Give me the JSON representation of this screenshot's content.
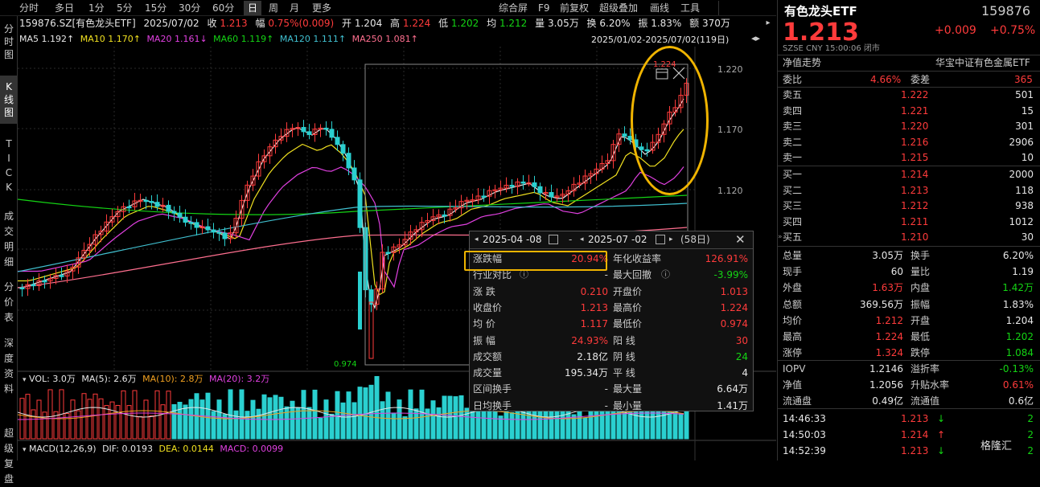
{
  "toolbar": {
    "items": [
      "分时",
      "多日",
      "1分",
      "5分",
      "15分",
      "30分",
      "60分",
      "日",
      "周",
      "月",
      "更多"
    ],
    "right": [
      "综合屏",
      "F9",
      "前复权",
      "超级叠加",
      "画线",
      "工具"
    ]
  },
  "lefttabs": [
    "分时图",
    "K线图",
    "TICK",
    "成交明细",
    "分价表",
    "深度资料",
    "超级复盘"
  ],
  "info": {
    "code": "159876.SZ[有色龙头ETF]",
    "date": "2025/07/02",
    "close_label": "收",
    "close": "1.213",
    "chg_label": "幅",
    "chg": "0.75%(0.009)",
    "open_label": "开",
    "open": "1.204",
    "high_label": "高",
    "high": "1.224",
    "low_label": "低",
    "low": "1.202",
    "avg_label": "均",
    "avg": "1.212",
    "vol_label": "量",
    "vol": "3.05万",
    "turn_label": "换",
    "turn": "6.20%",
    "amp_label": "振",
    "amp": "1.83%",
    "amt_label": "额",
    "amt": "370万"
  },
  "ma": {
    "ma5": "MA5  1.192↑",
    "ma10": "MA10  1.170↑",
    "ma20": "MA20  1.161↓",
    "ma60": "MA60  1.119↑",
    "ma120": "MA120  1.111↑",
    "ma250": "MA250  1.081↑"
  },
  "range_label": "2025/01/02-2025/07/02(119日)",
  "price_axis": [
    "1.220",
    "1.170",
    "1.120"
  ],
  "sel_box": {
    "high": "1.224",
    "low": "0.974"
  },
  "vol_line": {
    "vol": "VOL: 3.0万",
    "ma5": "MA(5): 2.6万",
    "ma10": "MA(10): 2.8万",
    "ma20": "MA(20): 3.2万"
  },
  "macd_line": {
    "macd_label": "MACD(12,26,9)",
    "dif": "DIF: 0.0193",
    "dea": "DEA: 0.0144",
    "macd": "MACD: 0.0099"
  },
  "popup": {
    "from": "2025-04 -08",
    "to": "2025-07 -02",
    "days": "(58日)",
    "rows": [
      {
        "l": "涨跌幅",
        "lv": "20.94%",
        "r": "年化收益率",
        "rv": "126.91%"
      },
      {
        "l": "行业对比",
        "lv": "-",
        "r": "最大回撤",
        "rv": "-3.99%"
      },
      {
        "l": "涨  跌",
        "lv": "0.210",
        "r": "开盘价",
        "rv": "1.013"
      },
      {
        "l": "收盘价",
        "lv": "1.213",
        "r": "最高价",
        "rv": "1.224"
      },
      {
        "l": "均  价",
        "lv": "1.117",
        "r": "最低价",
        "rv": "0.974"
      },
      {
        "l": "振  幅",
        "lv": "24.93%",
        "r": "阳  线",
        "rv": "30"
      },
      {
        "l": "成交额",
        "lv": "2.18亿",
        "r": "阴  线",
        "rv": "24"
      },
      {
        "l": "成交量",
        "lv": "195.34万",
        "r": "平  线",
        "rv": "4"
      },
      {
        "l": "区间换手",
        "lv": "-",
        "r": "最大量",
        "rv": "6.64万"
      },
      {
        "l": "日均换手",
        "lv": "-",
        "r": "最小量",
        "rv": "1.41万"
      }
    ]
  },
  "right": {
    "name": "有色龙头ETF",
    "code": "159876",
    "price": "1.213",
    "chg": "+0.009",
    "pct": "+0.75%",
    "market": "SZSE  CNY  15:00:06  闭市",
    "nav_trend": "净值走势",
    "index": "华宝中证有色金属ETF",
    "webi_label": "委比",
    "webi": "4.66%",
    "weicha_label": "委差",
    "weicha": "365",
    "asks": [
      [
        "卖五",
        "1.222",
        "501"
      ],
      [
        "卖四",
        "1.221",
        "15"
      ],
      [
        "卖三",
        "1.220",
        "301"
      ],
      [
        "卖二",
        "1.216",
        "2906"
      ],
      [
        "卖一",
        "1.215",
        "10"
      ]
    ],
    "bids": [
      [
        "买一",
        "1.214",
        "2000"
      ],
      [
        "买二",
        "1.213",
        "118"
      ],
      [
        "买三",
        "1.212",
        "938"
      ],
      [
        "买四",
        "1.211",
        "1012"
      ],
      [
        "买五",
        "1.210",
        "30"
      ]
    ],
    "stats": [
      [
        "总量",
        "3.05万",
        "换手",
        "6.20%"
      ],
      [
        "现手",
        "60",
        "量比",
        "1.19"
      ],
      [
        "外盘",
        "1.63万",
        "内盘",
        "1.42万"
      ],
      [
        "总额",
        "369.56万",
        "振幅",
        "1.83%"
      ],
      [
        "均价",
        "1.212",
        "开盘",
        "1.204"
      ],
      [
        "最高",
        "1.224",
        "最低",
        "1.202"
      ],
      [
        "涨停",
        "1.324",
        "跌停",
        "1.084"
      ]
    ],
    "stats2": [
      [
        "IOPV",
        "1.2146",
        "溢折率",
        "-0.13%"
      ],
      [
        "净值",
        "1.2056",
        "升贴水率",
        "0.61%"
      ],
      [
        "流通盘",
        "0.49亿",
        "流通值",
        "0.6亿"
      ]
    ],
    "ticks": [
      [
        "14:46:33",
        "1.213",
        "2"
      ],
      [
        "14:50:03",
        "1.214",
        "2"
      ],
      [
        "14:52:39",
        "1.213",
        "2"
      ]
    ],
    "watermark": "格隆汇"
  },
  "colors": {
    "up": "#ff3b3b",
    "down": "#14d414",
    "highlight": "#f0b400"
  }
}
